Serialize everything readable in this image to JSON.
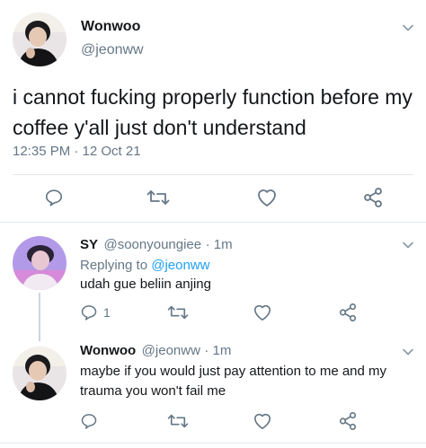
{
  "main_tweet": {
    "author_name": "Wonwoo",
    "author_handle": "@jeonww",
    "text": "i cannot fucking properly function before my coffee y'all just don't understand",
    "timestamp": "12:35 PM · 12 Oct 21"
  },
  "replies": [
    {
      "author_name": "SY",
      "author_handle": "@soonyoungiee",
      "time": "· 1m",
      "replying_prefix": "Replying to",
      "replying_to": "@jeonww",
      "text": "udah gue beliin anjing",
      "reply_count": "1"
    },
    {
      "author_name": "Wonwoo",
      "author_handle": "@jeonww",
      "time": "· 1m",
      "text": "maybe if you would just pay attention to me and my trauma you won't fail me"
    }
  ],
  "colors": {
    "text": "#14171a",
    "secondary": "#657786",
    "link": "#1da1f2",
    "divider": "#e1e8ed"
  },
  "icons": [
    "chevron-down-icon",
    "reply-icon",
    "retweet-icon",
    "like-icon",
    "share-icon"
  ]
}
